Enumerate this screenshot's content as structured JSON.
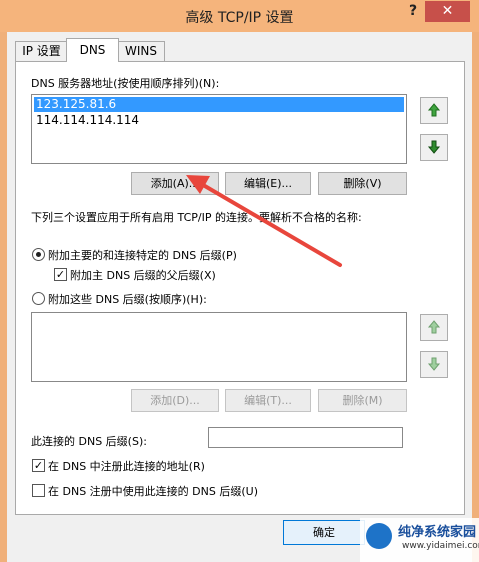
{
  "window": {
    "title": "高级 TCP/IP 设置",
    "help": "?",
    "close": "✕"
  },
  "tabs": [
    {
      "label": "IP 设置"
    },
    {
      "label": "DNS"
    },
    {
      "label": "WINS"
    }
  ],
  "dns": {
    "servers_label": "DNS 服务器地址(按使用顺序排列)(N):",
    "servers": [
      "123.125.81.6",
      "114.114.114.114"
    ],
    "add_label": "添加(A)...",
    "edit_label": "编辑(E)...",
    "delete_label": "删除(V)",
    "resolution_text": "下列三个设置应用于所有启用 TCP/IP 的连接。要解析不合格的名称:",
    "radio_primary_label": "附加主要的和连接特定的 DNS 后缀(P)",
    "check_parent_label": "附加主 DNS 后缀的父后缀(X)",
    "radio_these_label": "附加这些 DNS 后缀(按顺序)(H):",
    "suffix_add_label": "添加(D)...",
    "suffix_edit_label": "编辑(T)...",
    "suffix_delete_label": "删除(M)",
    "conn_suffix_label": "此连接的 DNS 后缀(S):",
    "conn_suffix_value": "",
    "register_label": "在 DNS 中注册此连接的地址(R)",
    "use_suffix_label": "在 DNS 注册中使用此连接的 DNS 后缀(U)"
  },
  "footer": {
    "ok_label": "确定"
  },
  "watermark": {
    "name": "纯净系统家园",
    "url": "www.yidaimei.com"
  },
  "colors": {
    "titlebar": "#f5b47c",
    "close": "#c7504a",
    "selection": "#3399ff",
    "arrow": "#e8463c",
    "updown": "#2e8b2e"
  }
}
